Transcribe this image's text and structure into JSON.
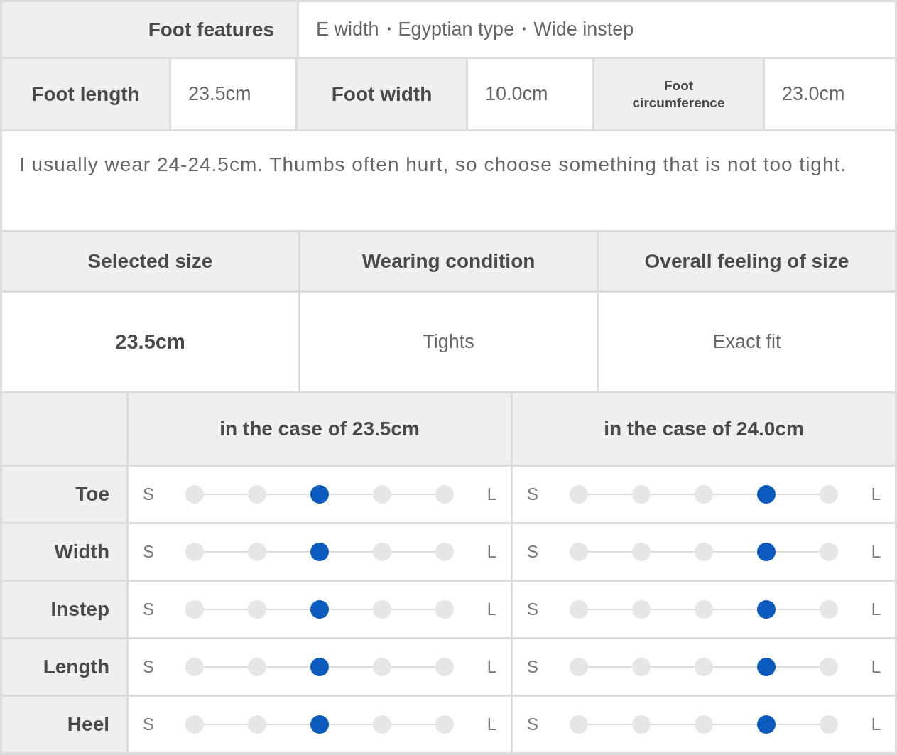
{
  "foot_features": {
    "label": "Foot features",
    "value": "E width・Egyptian type・Wide instep"
  },
  "measurements": [
    {
      "label": "Foot length",
      "value": "23.5cm",
      "small": false
    },
    {
      "label": "Foot width",
      "value": "10.0cm",
      "small": false
    },
    {
      "label": "Foot circumference",
      "value": "23.0cm",
      "small": true
    }
  ],
  "comment": "I usually wear 24-24.5cm. Thumbs often hurt, so choose something that is not too tight.",
  "summary": {
    "headers": [
      "Selected size",
      "Wearing condition",
      "Overall feeling of size"
    ],
    "values": [
      {
        "text": "23.5cm",
        "bold": true
      },
      {
        "text": "Tights",
        "bold": false
      },
      {
        "text": "Exact fit",
        "bold": false
      }
    ]
  },
  "fit_table": {
    "columns": [
      "in the case of 23.5cm",
      "in the case of 24.0cm"
    ],
    "rows": [
      {
        "label": "Toe",
        "ratings": [
          {
            "min": "S",
            "max": "L",
            "level": 0.5
          },
          {
            "min": "S",
            "max": "L",
            "level": 0.75
          }
        ]
      },
      {
        "label": "Width",
        "ratings": [
          {
            "min": "S",
            "max": "L",
            "level": 0.5
          },
          {
            "min": "S",
            "max": "L",
            "level": 0.75
          }
        ]
      },
      {
        "label": "Instep",
        "ratings": [
          {
            "min": "S",
            "max": "L",
            "level": 0.5
          },
          {
            "min": "S",
            "max": "L",
            "level": 0.75
          }
        ]
      },
      {
        "label": "Length",
        "ratings": [
          {
            "min": "S",
            "max": "L",
            "level": 0.5
          },
          {
            "min": "S",
            "max": "L",
            "level": 0.75
          }
        ]
      },
      {
        "label": "Heel",
        "ratings": [
          {
            "min": "S",
            "max": "L",
            "level": 0.5
          },
          {
            "min": "S",
            "max": "L",
            "level": 0.75
          }
        ]
      }
    ]
  }
}
